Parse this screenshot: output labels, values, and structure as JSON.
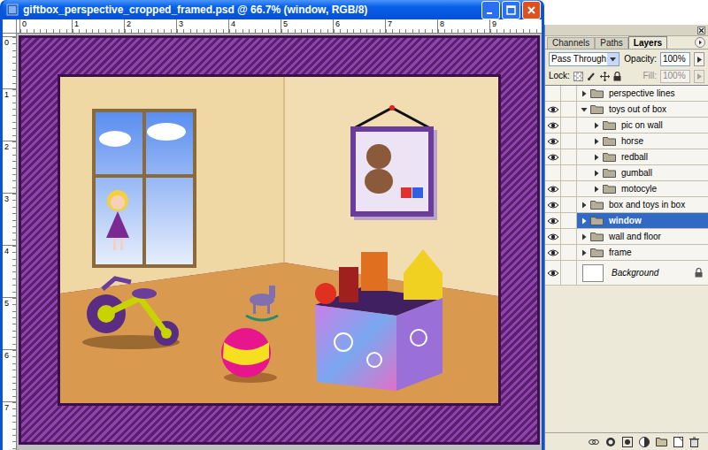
{
  "document": {
    "title": "giftbox_perspective_cropped_framed.psd @ 66.7% (window, RGB/8)"
  },
  "rulers": {
    "top": [
      "0",
      "1",
      "2",
      "3",
      "4",
      "5",
      "6",
      "7",
      "8",
      "9"
    ],
    "left": [
      "0",
      "1",
      "2",
      "3",
      "4",
      "5",
      "6",
      "7"
    ]
  },
  "layers_panel": {
    "tabs": [
      {
        "label": "Channels",
        "selected": false
      },
      {
        "label": "Paths",
        "selected": false
      },
      {
        "label": "Layers",
        "selected": true
      }
    ],
    "blend_mode": "Pass Through",
    "opacity": {
      "label": "Opacity:",
      "value": "100%"
    },
    "lock": {
      "label": "Lock:"
    },
    "fill": {
      "label": "Fill:",
      "value": "100%",
      "disabled": true
    },
    "layers": [
      {
        "name": "perspective lines",
        "kind": "group",
        "visible": false,
        "expanded": false,
        "child": false,
        "selected": false,
        "locked": false
      },
      {
        "name": "toys out of box",
        "kind": "group",
        "visible": true,
        "expanded": true,
        "child": false,
        "selected": false,
        "locked": false
      },
      {
        "name": "pic on wall",
        "kind": "group",
        "visible": true,
        "expanded": false,
        "child": true,
        "selected": false,
        "locked": false
      },
      {
        "name": "horse",
        "kind": "group",
        "visible": true,
        "expanded": false,
        "child": true,
        "selected": false,
        "locked": false
      },
      {
        "name": "redball",
        "kind": "group",
        "visible": true,
        "expanded": false,
        "child": true,
        "selected": false,
        "locked": false
      },
      {
        "name": "gumball",
        "kind": "group",
        "visible": false,
        "expanded": false,
        "child": true,
        "selected": false,
        "locked": false
      },
      {
        "name": "motocyle",
        "kind": "group",
        "visible": true,
        "expanded": false,
        "child": true,
        "selected": false,
        "locked": false
      },
      {
        "name": "box and toys in box",
        "kind": "group",
        "visible": true,
        "expanded": false,
        "child": false,
        "selected": false,
        "locked": false
      },
      {
        "name": "window",
        "kind": "group",
        "visible": true,
        "expanded": false,
        "child": false,
        "selected": true,
        "locked": false
      },
      {
        "name": "wall and floor",
        "kind": "group",
        "visible": true,
        "expanded": false,
        "child": false,
        "selected": false,
        "locked": false
      },
      {
        "name": "frame",
        "kind": "group",
        "visible": true,
        "expanded": false,
        "child": false,
        "selected": false,
        "locked": false
      },
      {
        "name": "Background",
        "kind": "background",
        "visible": true,
        "expanded": false,
        "child": false,
        "selected": false,
        "locked": true
      }
    ]
  }
}
